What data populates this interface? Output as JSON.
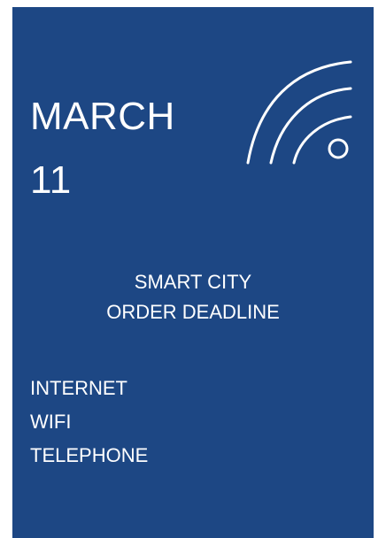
{
  "card": {
    "background": "#1d4784",
    "text_color": "#ffffff"
  },
  "date": {
    "month": "MARCH",
    "day": "11"
  },
  "icon": "wifi-signal-icon",
  "headline": {
    "line1": "SMART CITY",
    "line2": "ORDER DEADLINE"
  },
  "services": [
    "INTERNET",
    "WIFI",
    "TELEPHONE"
  ]
}
